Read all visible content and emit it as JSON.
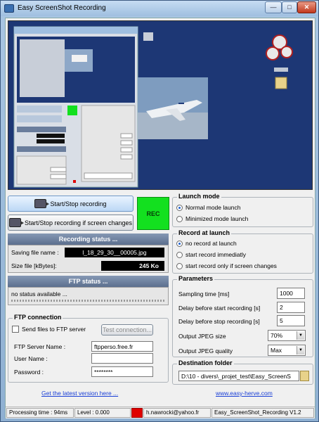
{
  "window": {
    "title": "Easy ScreenShot Recording",
    "min_label": "—",
    "max_label": "□",
    "close_label": "✕"
  },
  "buttons": {
    "start_stop": "Start/Stop recording",
    "start_stop_changes": "Start/Stop recording if screen changes",
    "rec_indicator": "REC"
  },
  "recording_status": {
    "title": "Recording status ...",
    "saving_label": "Saving file name :",
    "saving_value": "l_18_29_30__00005.jpg",
    "size_label": "Size file [kBytes]:",
    "size_value": "245 Ko"
  },
  "ftp_status": {
    "title": "FTP status ...",
    "message": "no status available ..."
  },
  "ftp_connection": {
    "title": "FTP connection",
    "send_label": "Send files to FTP server",
    "send_checked": false,
    "test_button": "Test connection...",
    "server_label": "FTP Server Name :",
    "server_value": "ftpperso.free.fr",
    "user_label": "User Name :",
    "user_value": "",
    "password_label": "Password :",
    "password_value": "********"
  },
  "launch_mode": {
    "title": "Launch mode",
    "options": [
      "Normal mode launch",
      "Minimized mode launch"
    ],
    "selected": 0
  },
  "record_at_launch": {
    "title": "Record at launch",
    "options": [
      "no record at launch",
      "start record immediatly",
      "start record only if screen changes"
    ],
    "selected": 0
  },
  "parameters": {
    "title": "Parameters",
    "sampling_label": "Sampling time [ms]",
    "sampling_value": "1000",
    "delay_start_label": "Delay before start recording [s]",
    "delay_start_value": "2",
    "delay_stop_label": "Delay before stop recording [s]",
    "delay_stop_value": "5",
    "jpeg_size_label": "Output JPEG size",
    "jpeg_size_value": "70%",
    "jpeg_quality_label": "Output JPEG quality",
    "jpeg_quality_value": "Max"
  },
  "destination": {
    "title": "Destination folder",
    "path": "D:\\10 - divers\\_projet_test\\Easy_ScreenS"
  },
  "links": {
    "latest_version": "Get the latest version here ...",
    "website": "www.easy-herve.com"
  },
  "statusbar": {
    "processing": "Processing time : 94ms",
    "level": "Level : 0.000",
    "email": "h.nawrocki@yahoo.fr",
    "version": "Easy_ScreenShot_Recording V1.2",
    "indicator_color": "#e00000"
  },
  "colors": {
    "rec_green": "#13e01f",
    "desktop_blue": "#1d3775",
    "header_slate": "#6a7d9c"
  }
}
